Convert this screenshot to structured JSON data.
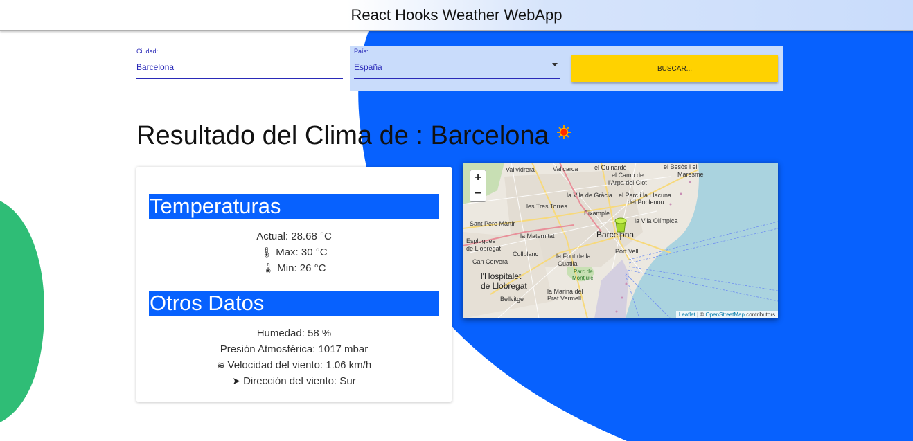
{
  "app": {
    "title": "React Hooks Weather WebApp"
  },
  "form": {
    "city_label": "Ciudad:",
    "city_value": "Barcelona",
    "country_label": "País:",
    "country_value": "España",
    "search_label": "BUSCAR..."
  },
  "result": {
    "title": "Resultado del Clima de : Barcelona",
    "weather_icon": "sun-icon"
  },
  "temps": {
    "heading": "Temperaturas",
    "actual": "Actual: 28.68 °C",
    "max": "Max: 30 °C",
    "min": "Min: 26 °C"
  },
  "other": {
    "heading": "Otros Datos",
    "humidity": "Humedad: 58 %",
    "pressure": "Presión Atmosférica: 1017 mbar",
    "wind_speed": "Velocidad del viento: 1.06 km/h",
    "wind_dir": "Dirección del viento: Sur"
  },
  "map": {
    "zoom_in": "+",
    "zoom_out": "−",
    "attrib_leaflet": "Leaflet",
    "attrib_sep": " | © ",
    "attrib_osm": "OpenStreetMap",
    "attrib_contrib": " contributors",
    "labels": {
      "vallvidrera": "Vallvidrera",
      "vallcarca": "Vallcarca",
      "guinardo": "el Guinardó",
      "besos": "el Besòs i el",
      "maresme": "Maresme",
      "campo": "el Camp de",
      "arpa": "l'Arpa del Clot",
      "gracia": "la Vila de Gràcia",
      "parc": "el Parc i la Llacuna",
      "poblenou": "del Poblenou",
      "torres": "les Tres Torres",
      "eixample": "Eixample",
      "olimpica": "la Vila Olímpica",
      "santpere": "Sant Pere Màrtir",
      "esplugues": "Esplugues",
      "llobregat1": "de Llobregat",
      "maternitat": "la Maternitat",
      "barcelona": "Barcelona",
      "portvell": "Port Vell",
      "collblanc": "Collblanc",
      "fontguatlla": "la Font de la",
      "guatlla": "Guatlla",
      "cancervera": "Can Cervera",
      "hospitalet": "l'Hospitalet",
      "llobregat2": "de Llobregat",
      "parcmontjuic": "Parc de",
      "montjuic": "Montjuïc",
      "marina": "la Marina del",
      "pratvermell": "Prat Vermell",
      "bellvitge": "Bellvitge"
    }
  },
  "colors": {
    "blue": "#0761fe",
    "green": "#2fbd76",
    "yellow": "#ffd200",
    "light_blue": "#c9dcfb"
  }
}
